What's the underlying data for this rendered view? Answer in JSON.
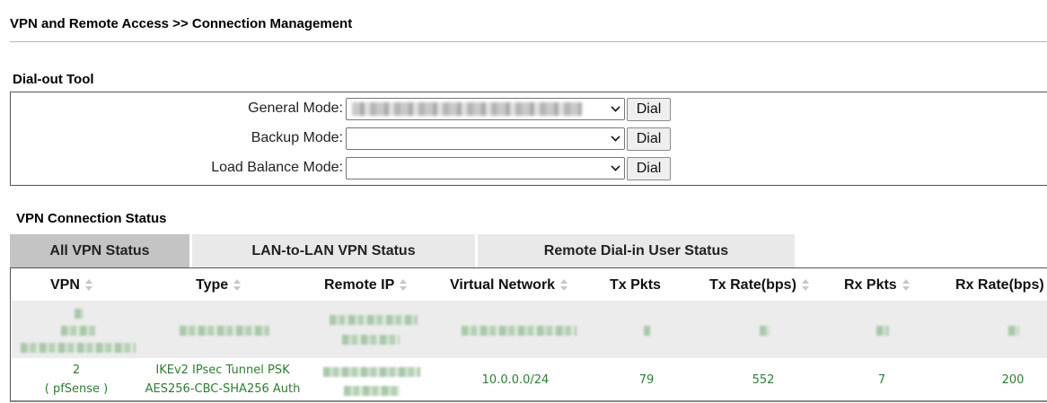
{
  "page_title": "VPN and Remote Access >> Connection Management",
  "dialout": {
    "heading": "Dial-out Tool",
    "rows": [
      {
        "label": "General Mode:",
        "value": "",
        "button": "Dial"
      },
      {
        "label": "Backup Mode:",
        "value": "",
        "button": "Dial"
      },
      {
        "label": "Load Balance Mode:",
        "value": "",
        "button": "Dial"
      }
    ]
  },
  "vpn_status": {
    "heading": "VPN Connection Status",
    "tabs": [
      {
        "label": "All VPN Status",
        "active": true
      },
      {
        "label": "LAN-to-LAN VPN Status",
        "active": false
      },
      {
        "label": "Remote Dial-in User Status",
        "active": false
      }
    ],
    "columns": [
      "VPN",
      "Type",
      "Remote IP",
      "Virtual Network",
      "Tx Pkts",
      "Tx Rate(bps)",
      "Rx Pkts",
      "Rx Rate(bps)"
    ],
    "row": {
      "vpn_line1": "2",
      "vpn_line2": "( pfSense )",
      "type_line1": "IKEv2 IPsec Tunnel PSK",
      "type_line2": "AES256-CBC-SHA256 Auth",
      "virtual_network": "10.0.0.0/24",
      "tx_pkts": "79",
      "tx_rate": "552",
      "rx_pkts": "7",
      "rx_rate": "200"
    }
  },
  "colors": {
    "cell_text": "#2e7d32",
    "active_tab": "#c4c4c4",
    "tab": "#e9e9e9",
    "blurred_row": "#ececec"
  },
  "icons": [
    "chevron-down-icon",
    "sort-icon"
  ]
}
